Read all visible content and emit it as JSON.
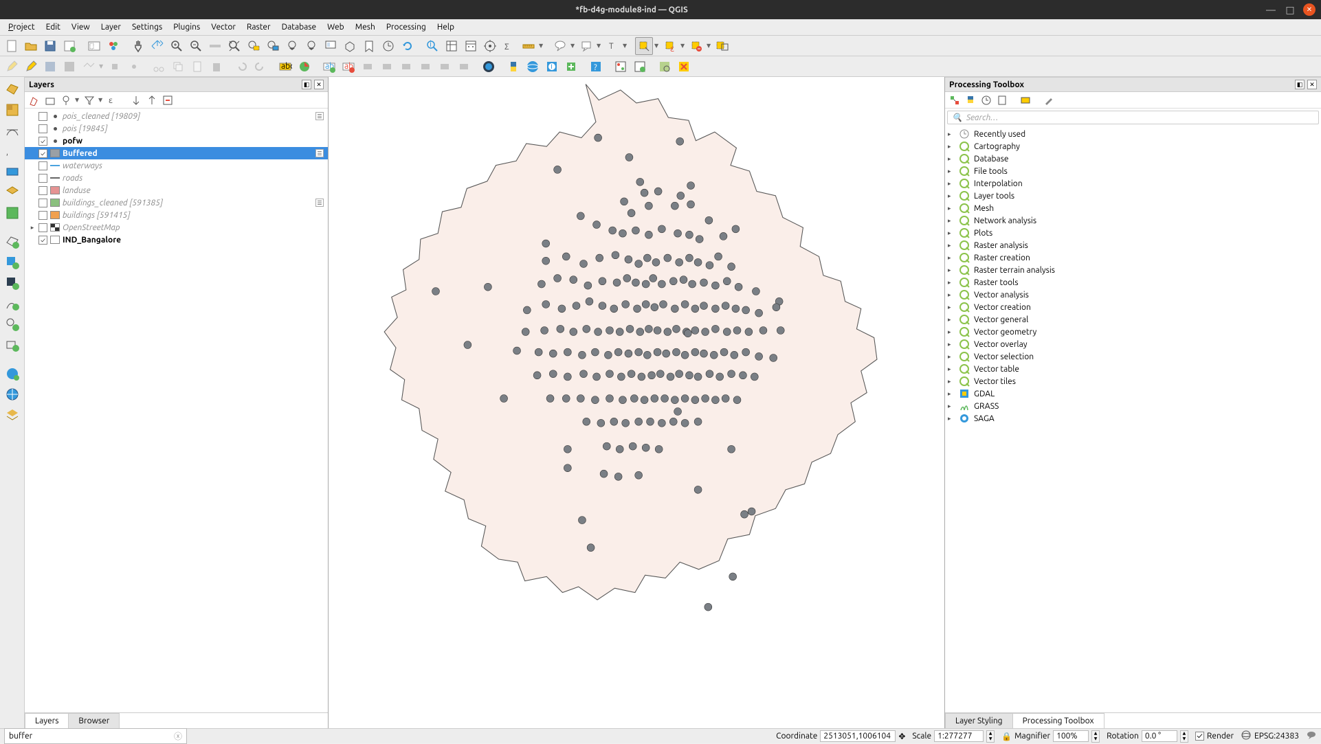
{
  "window": {
    "title": "*fb-d4g-module8-ind — QGIS"
  },
  "menubar": {
    "project": "Project",
    "edit": "Edit",
    "view": "View",
    "layer": "Layer",
    "settings": "Settings",
    "plugins": "Plugins",
    "vector": "Vector",
    "raster": "Raster",
    "database": "Database",
    "web": "Web",
    "mesh": "Mesh",
    "processing": "Processing",
    "help": "Help"
  },
  "layers_panel": {
    "title": "Layers",
    "tabs": {
      "layers": "Layers",
      "browser": "Browser"
    },
    "items": [
      {
        "checked": false,
        "swatch_type": "dot",
        "swatch": "#555",
        "name": "pois_cleaned [19809]",
        "bold": false,
        "count": true
      },
      {
        "checked": false,
        "swatch_type": "dot",
        "swatch": "#555",
        "name": "pois [19845]",
        "bold": false,
        "count": false
      },
      {
        "checked": true,
        "swatch_type": "dot",
        "swatch": "#555",
        "name": "pofw",
        "bold": true,
        "count": false
      },
      {
        "checked": true,
        "swatch_type": "box",
        "swatch": "#9aa0a6",
        "name": "Buffered",
        "bold": true,
        "selected": true,
        "count": true
      },
      {
        "checked": false,
        "swatch_type": "line",
        "swatch": "#4aa3df",
        "name": "waterways",
        "bold": false
      },
      {
        "checked": false,
        "swatch_type": "line",
        "swatch": "#666",
        "name": "roads",
        "bold": false
      },
      {
        "checked": false,
        "swatch_type": "box",
        "swatch": "#e59393",
        "name": "landuse",
        "bold": false
      },
      {
        "checked": false,
        "swatch_type": "box",
        "swatch": "#8bc07f",
        "name": "buildings_cleaned [591385]",
        "bold": false,
        "count": true
      },
      {
        "checked": false,
        "swatch_type": "box",
        "swatch": "#f0a050",
        "name": "buildings [591415]",
        "bold": false
      },
      {
        "checked": false,
        "swatch_type": "osm",
        "name": "OpenStreetMap",
        "bold": false,
        "exp": true
      },
      {
        "checked": true,
        "swatch_type": "box",
        "swatch": "#ffffff",
        "name": "IND_Bangalore",
        "bold": true
      }
    ]
  },
  "processing": {
    "title": "Processing Toolbox",
    "search_placeholder": "Search…",
    "tabs": {
      "styling": "Layer Styling",
      "toolbox": "Processing Toolbox"
    },
    "items": [
      {
        "icon": "clock",
        "name": "Recently used"
      },
      {
        "icon": "q",
        "name": "Cartography"
      },
      {
        "icon": "q",
        "name": "Database"
      },
      {
        "icon": "q",
        "name": "File tools"
      },
      {
        "icon": "q",
        "name": "Interpolation"
      },
      {
        "icon": "q",
        "name": "Layer tools"
      },
      {
        "icon": "q",
        "name": "Mesh"
      },
      {
        "icon": "q",
        "name": "Network analysis"
      },
      {
        "icon": "q",
        "name": "Plots"
      },
      {
        "icon": "q",
        "name": "Raster analysis"
      },
      {
        "icon": "q",
        "name": "Raster creation"
      },
      {
        "icon": "q",
        "name": "Raster terrain analysis"
      },
      {
        "icon": "q",
        "name": "Raster tools"
      },
      {
        "icon": "q",
        "name": "Vector analysis"
      },
      {
        "icon": "q",
        "name": "Vector creation"
      },
      {
        "icon": "q",
        "name": "Vector general"
      },
      {
        "icon": "q",
        "name": "Vector geometry"
      },
      {
        "icon": "q",
        "name": "Vector overlay"
      },
      {
        "icon": "q",
        "name": "Vector selection"
      },
      {
        "icon": "q",
        "name": "Vector table"
      },
      {
        "icon": "q",
        "name": "Vector tiles"
      },
      {
        "icon": "gdal",
        "name": "GDAL"
      },
      {
        "icon": "grass",
        "name": "GRASS"
      },
      {
        "icon": "saga",
        "name": "SAGA"
      }
    ]
  },
  "statusbar": {
    "search": "buffer",
    "coord_label": "Coordinate",
    "coord_value": "2513051,1006104",
    "scale_label": "Scale",
    "scale_value": "1:277277",
    "magnifier_label": "Magnifier",
    "magnifier_value": "100%",
    "rotation_label": "Rotation",
    "rotation_value": "0.0 °",
    "render_label": "Render",
    "crs": "EPSG:24383"
  }
}
